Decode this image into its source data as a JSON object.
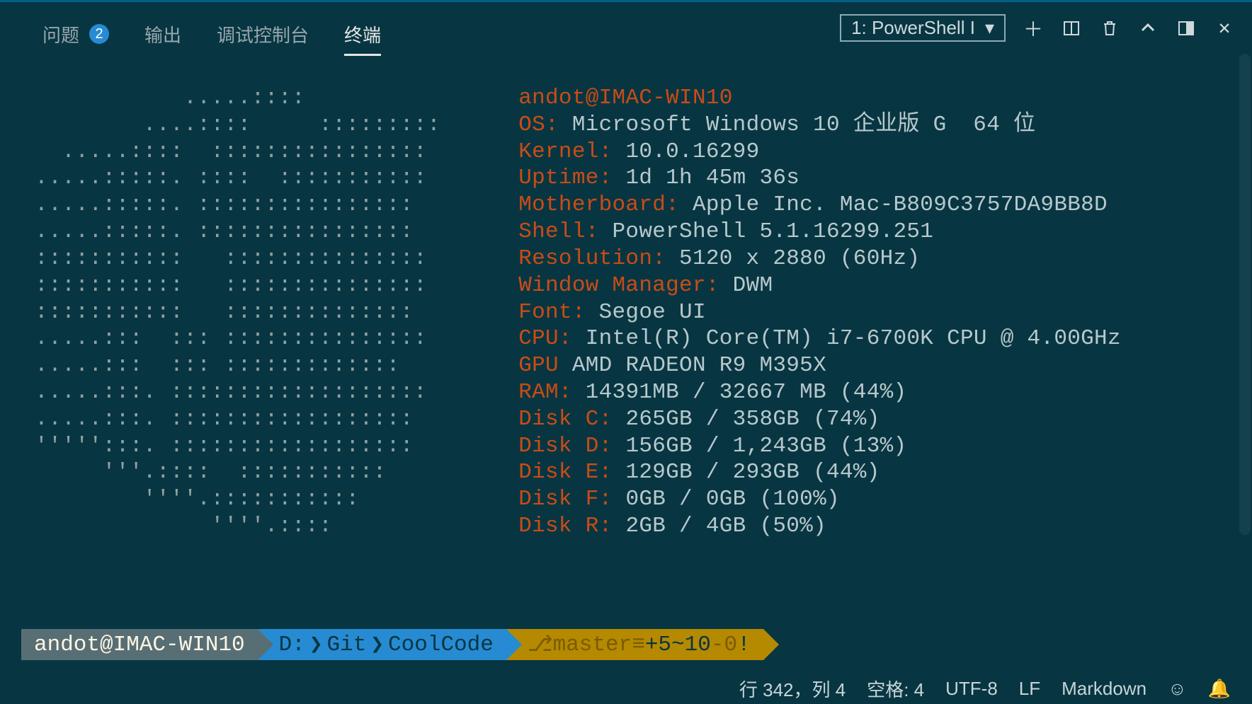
{
  "tabs": {
    "problems": {
      "label": "问题",
      "badge": "2"
    },
    "output": {
      "label": "输出"
    },
    "debug": {
      "label": "调试控制台"
    },
    "terminal": {
      "label": "终端"
    }
  },
  "terminalSelect": {
    "value": "1: PowerShell I"
  },
  "ascii": "            .....::::\n         ....::::     :::::::::\n   .....::::  ::::::::::::::::\n .....:::::. ::::  :::::::::::\n .....:::::. ::::::::::::::::\n .....:::::. ::::::::::::::::\n :::::::::::   :::::::::::::::\n :::::::::::   :::::::::::::::\n :::::::::::   ::::::::::::::\n .....:::  ::: :::::::::::::::\n .....:::  ::: :::::::::::::\n .....:::. :::::::::::::::::::\n .....:::. ::::::::::::::::::\n ''''':::. ::::::::::::::::::\n      '''.::::  :::::::::::\n         ''''.:::::::::::\n              ''''.::::",
  "sysinfo": {
    "user": "andot@IMAC-WIN10",
    "os_label": "OS:",
    "os": "Microsoft Windows 10 企业版 G  64 位",
    "kernel_label": "Kernel:",
    "kernel": "10.0.16299",
    "uptime_label": "Uptime:",
    "uptime": "1d 1h 45m 36s",
    "mb_label": "Motherboard:",
    "mb": "Apple Inc. Mac-B809C3757DA9BB8D",
    "shell_label": "Shell:",
    "shell": "PowerShell 5.1.16299.251",
    "res_label": "Resolution:",
    "res": "5120 x 2880 (60Hz)",
    "wm_label": "Window Manager:",
    "wm": "DWM",
    "font_label": "Font:",
    "font": "Segoe UI",
    "cpu_label": "CPU:",
    "cpu": "Intel(R) Core(TM) i7-6700K CPU @ 4.00GHz",
    "gpu_label": "GPU",
    "gpu": "AMD RADEON R9 M395X",
    "ram_label": "RAM:",
    "ram": "14391MB / 32667 MB (44%)",
    "dc_label": "Disk C:",
    "dc": "265GB / 358GB (74%)",
    "dd_label": "Disk D:",
    "dd": "156GB / 1,243GB (13%)",
    "de_label": "Disk E:",
    "de": "129GB / 293GB (44%)",
    "df_label": "Disk F:",
    "df": "0GB / 0GB (100%)",
    "dr_label": "Disk R:",
    "dr": "2GB / 4GB (50%)"
  },
  "prompt": {
    "user": " andot@IMAC-WIN10 ",
    "path_d": "D:",
    "path_git": "Git",
    "path_repo": "CoolCode",
    "branch": "master",
    "plus": "+5",
    "tilde": "~10",
    "minus": "-0",
    "bang": "!"
  },
  "status": {
    "pos": "行 342，列 4",
    "spaces": "空格: 4",
    "enc": "UTF-8",
    "eol": "LF",
    "lang": "Markdown"
  }
}
